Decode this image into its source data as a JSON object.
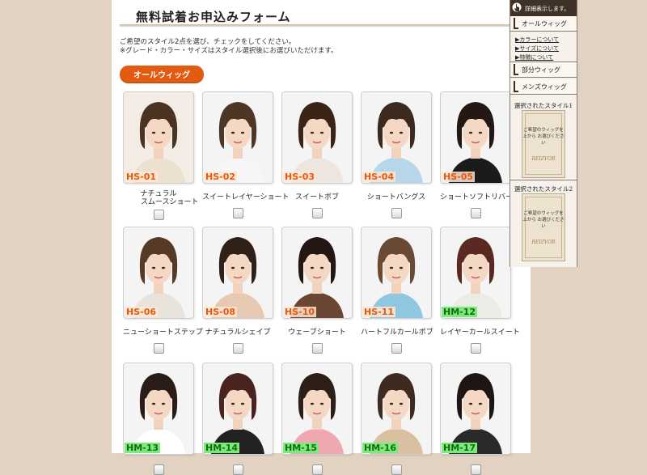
{
  "page": {
    "title": "無料試着お申込みフォーム",
    "instruction_line1": "ご希望のスタイル2点を選び、チェックをしてください。",
    "instruction_line2": "※グレード・カラー・サイズはスタイル選択後にお選びいただけます。",
    "category_label": "オールウィッグ"
  },
  "styles": [
    {
      "code": "HS-01",
      "name_line1": "ナチュラル",
      "name_line2": "スムースショート",
      "series": "hs",
      "hair": "#4a3322",
      "bg": "#f2ece4",
      "cloth": "#ece1cf"
    },
    {
      "code": "HS-02",
      "name_line1": "スイートレイヤーショート",
      "name_line2": "",
      "series": "hs",
      "hair": "#4e3626",
      "bg": "#f4f4f4",
      "cloth": "#f6f6f6"
    },
    {
      "code": "HS-03",
      "name_line1": "スイートボブ",
      "name_line2": "",
      "series": "hs",
      "hair": "#3b2318",
      "bg": "#f4f4f4",
      "cloth": "#ece6df"
    },
    {
      "code": "HS-04",
      "name_line1": "ショートバングス",
      "name_line2": "",
      "series": "hs",
      "hair": "#3c2a1e",
      "bg": "#f4f4f4",
      "cloth": "#b8d6ea"
    },
    {
      "code": "HS-05",
      "name_line1": "ショートソフトリバース",
      "name_line2": "",
      "series": "hs",
      "hair": "#231813",
      "bg": "#f4f4f4",
      "cloth": "#1b1b1b"
    },
    {
      "code": "HS-06",
      "name_line1": "ニューショートステップ",
      "name_line2": "",
      "series": "hs",
      "hair": "#573a26",
      "bg": "#f4f4f4",
      "cloth": "#e8e4dc"
    },
    {
      "code": "HS-08",
      "name_line1": "ナチュラルシェイプ",
      "name_line2": "",
      "series": "hs",
      "hair": "#2f2018",
      "bg": "#f4f4f4",
      "cloth": "#e7c9b3"
    },
    {
      "code": "HS-10",
      "name_line1": "ウェーブショート",
      "name_line2": "",
      "series": "hs",
      "hair": "#221712",
      "bg": "#f4f4f4",
      "cloth": "#6b4632"
    },
    {
      "code": "HS-11",
      "name_line1": "ハートフルカールボブ",
      "name_line2": "",
      "series": "hs",
      "hair": "#6a4a34",
      "bg": "#f4f4f4",
      "cloth": "#8fc7e0"
    },
    {
      "code": "HM-12",
      "name_line1": "レイヤーカールスイート",
      "name_line2": "",
      "series": "hm",
      "hair": "#5a2a22",
      "bg": "#f4f4f4",
      "cloth": "#ecece6"
    },
    {
      "code": "HM-13",
      "name_line1": "",
      "name_line2": "",
      "series": "hm",
      "hair": "#2a1c16",
      "bg": "#f4f4f4",
      "cloth": "#ffffff"
    },
    {
      "code": "HM-14",
      "name_line1": "",
      "name_line2": "",
      "series": "hm",
      "hair": "#4a2220",
      "bg": "#f4f4f4",
      "cloth": "#222222"
    },
    {
      "code": "HM-15",
      "name_line1": "",
      "name_line2": "",
      "series": "hm",
      "hair": "#2e1e18",
      "bg": "#f4f4f4",
      "cloth": "#f0a8b0"
    },
    {
      "code": "HM-16",
      "name_line1": "",
      "name_line2": "",
      "series": "hm",
      "hair": "#3e2a20",
      "bg": "#f4f4f4",
      "cloth": "#d8c0a0"
    },
    {
      "code": "HM-17",
      "name_line1": "",
      "name_line2": "",
      "series": "hm",
      "hair": "#1e1612",
      "bg": "#f4f4f4",
      "cloth": "#2a2a2a"
    }
  ],
  "sidebar": {
    "banner_text": "詳細表示します。",
    "nav_all": "オールウィッグ",
    "links": [
      "▶カラーについて",
      "▶サイズについて",
      "▶特徴について"
    ],
    "nav_partial": "部分ウィッグ",
    "nav_mens": "メンズウィッグ",
    "selected1_title": "選択されたスタイル1",
    "selected2_title": "選択されたスタイル2",
    "slot_text_line1": "ご希望のウィッグを",
    "slot_text_line2": "上から お選びください",
    "logo_text": "REIZVOR"
  }
}
